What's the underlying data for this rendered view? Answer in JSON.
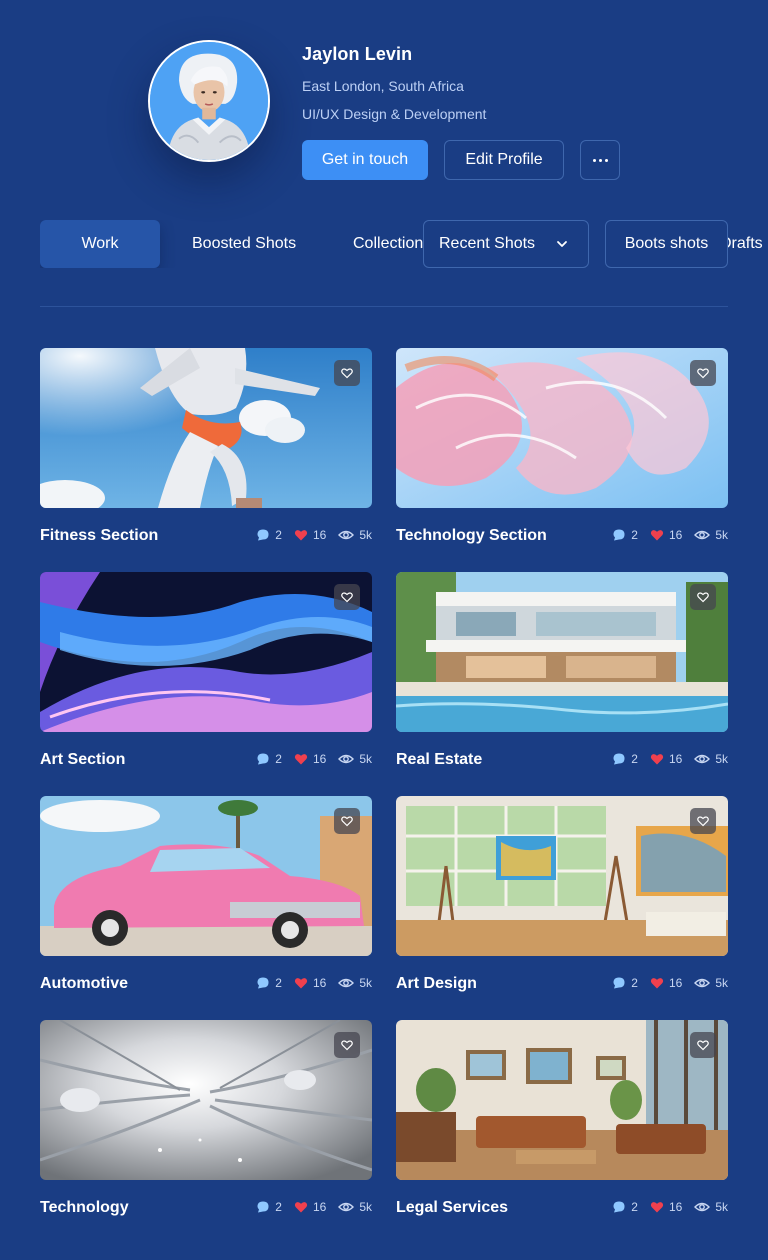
{
  "profile": {
    "name": "Jaylon Levin",
    "location": "East London, South Africa",
    "role": "UI/UX Design & Development",
    "avatar_icon": "portrait-avatar"
  },
  "actions": {
    "contact_label": "Get in touch",
    "edit_label": "Edit Profile",
    "more_icon": "more-dots-icon"
  },
  "tabs": {
    "work": "Work",
    "boosted": "Boosted Shots",
    "collections": "Collections",
    "recent": "Recent Shots",
    "boots": "Boots shots",
    "drafts": "Drafts"
  },
  "shots": [
    {
      "title": "Fitness Section",
      "comments": "2",
      "likes": "16",
      "views": "5k"
    },
    {
      "title": "Technology Section",
      "comments": "2",
      "likes": "16",
      "views": "5k"
    },
    {
      "title": "Art Section",
      "comments": "2",
      "likes": "16",
      "views": "5k"
    },
    {
      "title": "Real Estate",
      "comments": "2",
      "likes": "16",
      "views": "5k"
    },
    {
      "title": "Automotive",
      "comments": "2",
      "likes": "16",
      "views": "5k"
    },
    {
      "title": "Art Design",
      "comments": "2",
      "likes": "16",
      "views": "5k"
    },
    {
      "title": "Technology",
      "comments": "2",
      "likes": "16",
      "views": "5k"
    },
    {
      "title": "Legal Services",
      "comments": "2",
      "likes": "16",
      "views": "5k"
    }
  ],
  "colors": {
    "background": "#1a3d84",
    "primary": "#3d8ff5",
    "active_tab": "#2655a8",
    "like": "#f0404e",
    "comment": "#8fc8ff"
  }
}
